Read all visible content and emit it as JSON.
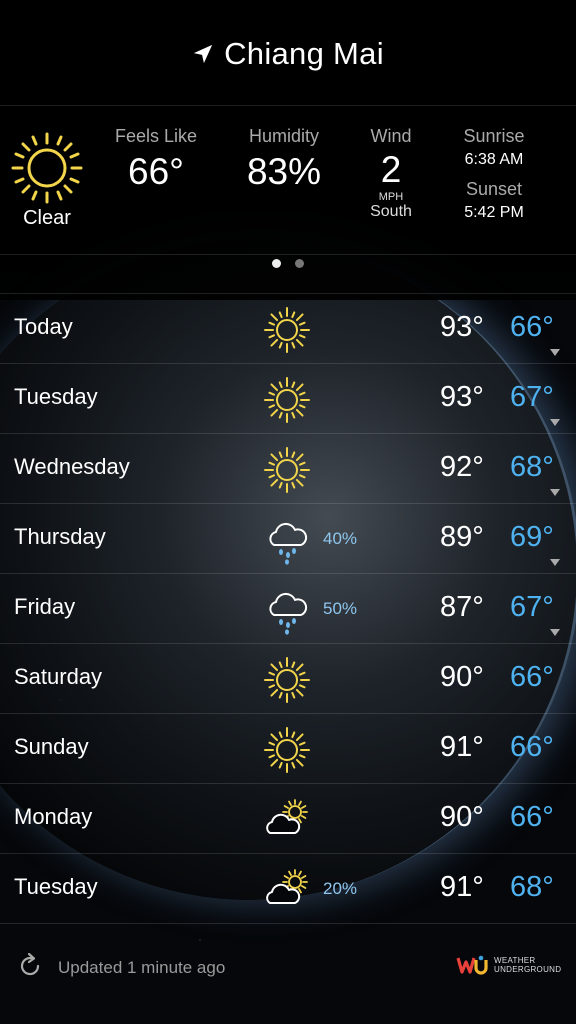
{
  "header": {
    "location": "Chiang Mai",
    "icon": "location-arrow-icon"
  },
  "current": {
    "condition": "Clear",
    "icon": "sun-icon",
    "feels_like": {
      "label": "Feels Like",
      "value": "66°"
    },
    "humidity": {
      "label": "Humidity",
      "value": "83%"
    },
    "wind": {
      "label": "Wind",
      "value": "2",
      "unit": "MPH",
      "direction": "South"
    },
    "sunrise": {
      "label": "Sunrise",
      "value": "6:38 AM"
    },
    "sunset": {
      "label": "Sunset",
      "value": "5:42 PM"
    }
  },
  "pager": {
    "pages": 2,
    "active": 0
  },
  "forecast": [
    {
      "day": "Today",
      "icon": "sun-icon",
      "pop": "",
      "hi": "93°",
      "lo": "66°",
      "expand": true
    },
    {
      "day": "Tuesday",
      "icon": "sun-icon",
      "pop": "",
      "hi": "93°",
      "lo": "67°",
      "expand": true
    },
    {
      "day": "Wednesday",
      "icon": "sun-icon",
      "pop": "",
      "hi": "92°",
      "lo": "68°",
      "expand": true
    },
    {
      "day": "Thursday",
      "icon": "rain-cloud-icon",
      "pop": "40%",
      "hi": "89°",
      "lo": "69°",
      "expand": true
    },
    {
      "day": "Friday",
      "icon": "rain-cloud-icon",
      "pop": "50%",
      "hi": "87°",
      "lo": "67°",
      "expand": true
    },
    {
      "day": "Saturday",
      "icon": "sun-icon",
      "pop": "",
      "hi": "90°",
      "lo": "66°",
      "expand": false
    },
    {
      "day": "Sunday",
      "icon": "sun-icon",
      "pop": "",
      "hi": "91°",
      "lo": "66°",
      "expand": false
    },
    {
      "day": "Monday",
      "icon": "partly-cloudy-icon",
      "pop": "",
      "hi": "90°",
      "lo": "66°",
      "expand": false
    },
    {
      "day": "Tuesday",
      "icon": "partly-cloudy-icon",
      "pop": "20%",
      "hi": "91°",
      "lo": "68°",
      "expand": false
    }
  ],
  "footer": {
    "updated": "Updated 1 minute ago",
    "brand_line1": "WEATHER",
    "brand_line2": "UNDERGROUND"
  },
  "colors": {
    "low_temp": "#4fb2f0",
    "pop": "#8ec6ee",
    "sun": "#f2d54a"
  }
}
